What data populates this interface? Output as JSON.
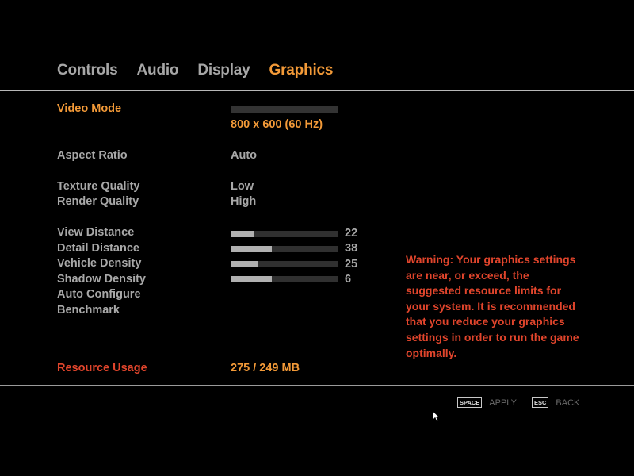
{
  "tabs": [
    {
      "label": "Controls",
      "active": false
    },
    {
      "label": "Audio",
      "active": false
    },
    {
      "label": "Display",
      "active": false
    },
    {
      "label": "Graphics",
      "active": true
    }
  ],
  "video_mode": {
    "label": "Video Mode",
    "value": "800 x 600 (60 Hz)"
  },
  "aspect_ratio": {
    "label": "Aspect Ratio",
    "value": "Auto"
  },
  "texture_quality": {
    "label": "Texture Quality",
    "value": "Low"
  },
  "render_quality": {
    "label": "Render Quality",
    "value": "High"
  },
  "sliders": [
    {
      "label": "View Distance",
      "value": "22",
      "fill_fraction": 0.22
    },
    {
      "label": "Detail Distance",
      "value": "38",
      "fill_fraction": 0.38
    },
    {
      "label": "Vehicle Density",
      "value": "25",
      "fill_fraction": 0.25
    },
    {
      "label": "Shadow Density",
      "value": "6",
      "fill_fraction": 0.38
    }
  ],
  "auto_configure_label": "Auto Configure",
  "benchmark_label": "Benchmark",
  "resource_usage": {
    "label": "Resource Usage",
    "value": "275 / 249 MB"
  },
  "warning_text": "Warning: Your graphics settings are near, or exceed, the suggested resource limits for your system. It is recommended that you reduce your graphics settings in order to run the game optimally.",
  "hints": {
    "apply_key": "SPACE",
    "apply_label": "APPLY",
    "back_key": "ESC",
    "back_label": "BACK"
  },
  "colors": {
    "accent": "#f39a38",
    "warning": "#e1452c",
    "text": "#a8a8a8",
    "background": "#000000"
  }
}
